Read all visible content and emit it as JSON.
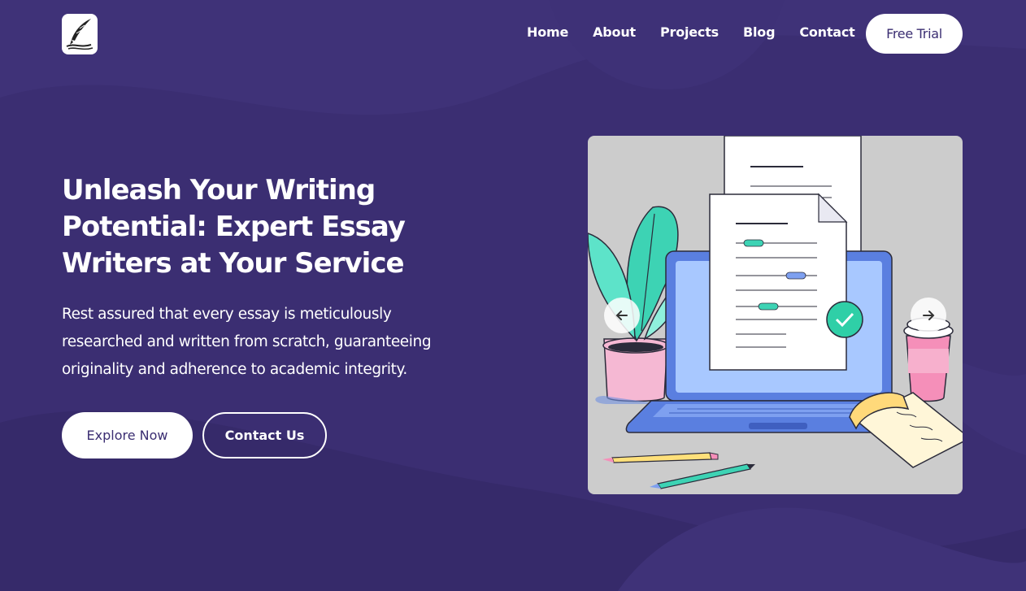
{
  "colors": {
    "background": "#3b2e72",
    "primary_text": "#ffffff",
    "button_text": "#3b2e72",
    "illustration_bg": "#cccccc"
  },
  "nav": {
    "logo_icon": "quill-pen-icon",
    "links": [
      "Home",
      "About",
      "Projects",
      "Blog",
      "Contact"
    ],
    "cta": "Free Trial"
  },
  "hero": {
    "title": "Unleash Your Writing Potential: Expert Essay Writers at Your Service",
    "description": "Rest assured that every essay is meticulously researched and written from scratch, guaranteeing originality and adherence to academic integrity.",
    "primary_button": "Explore Now",
    "secondary_button": "Contact Us"
  },
  "carousel": {
    "prev_icon": "arrow-left-icon",
    "next_icon": "arrow-right-icon"
  }
}
